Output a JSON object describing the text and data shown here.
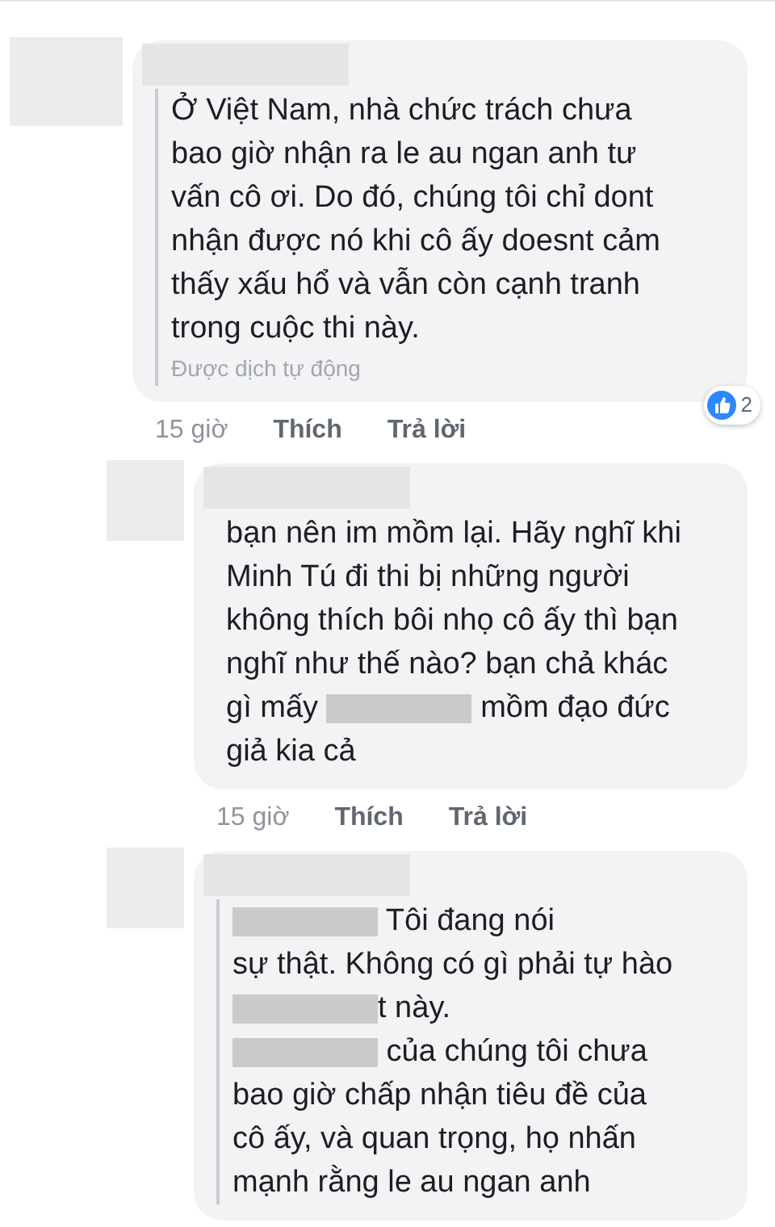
{
  "comments": [
    {
      "translated": true,
      "lines": [
        [
          {
            "kind": "text",
            "text": "Ở Việt Nam, nhà chức trách chưa"
          }
        ],
        [
          {
            "kind": "text",
            "text": "bao giờ nhận ra le au ngan anh tư"
          }
        ],
        [
          {
            "kind": "text",
            "text": "vấn cô ơi. Do đó, chúng tôi chỉ dont"
          }
        ],
        [
          {
            "kind": "text",
            "text": "nhận được nó khi cô ấy doesnt cảm"
          }
        ],
        [
          {
            "kind": "text",
            "text": "thấy xấu hổ và vẫn còn cạnh tranh"
          }
        ],
        [
          {
            "kind": "text",
            "text": "trong cuộc thi này."
          }
        ]
      ],
      "translation_note": "Được dịch tự động",
      "time": "15 giờ",
      "like": "Thích",
      "reply": "Trả lời",
      "reaction_count": "2"
    },
    {
      "translated": false,
      "lines": [
        [
          {
            "kind": "text",
            "text": "bạn nên im mồm lại. Hãy nghĩ khi"
          }
        ],
        [
          {
            "kind": "text",
            "text": "Minh Tú đi thi bị những người"
          }
        ],
        [
          {
            "kind": "text",
            "text": "không thích bôi nhọ cô ấy thì bạn"
          }
        ],
        [
          {
            "kind": "text",
            "text": "nghĩ như thế nào? bạn chả khác"
          }
        ],
        [
          {
            "kind": "text",
            "text": "gì mấy "
          },
          {
            "kind": "redacted"
          },
          {
            "kind": "text",
            "text": " mồm đạo đức"
          }
        ],
        [
          {
            "kind": "text",
            "text": "giả kia cả"
          }
        ]
      ],
      "time": "15 giờ",
      "like": "Thích",
      "reply": "Trả lời"
    },
    {
      "translated": true,
      "lines": [
        [
          {
            "kind": "redacted"
          },
          {
            "kind": "text",
            "text": " Tôi đang nói"
          }
        ],
        [
          {
            "kind": "text",
            "text": "sự thật. Không có gì phải tự hào"
          }
        ],
        [
          {
            "kind": "redacted"
          },
          {
            "kind": "text",
            "text": "t này."
          }
        ],
        [
          {
            "kind": "redacted"
          },
          {
            "kind": "text",
            "text": " của chúng tôi chưa"
          }
        ],
        [
          {
            "kind": "text",
            "text": "bao giờ chấp nhận tiêu đề của"
          }
        ],
        [
          {
            "kind": "text",
            "text": "cô ấy, và quan trọng, họ nhấn"
          }
        ],
        [
          {
            "kind": "text",
            "text": "mạnh rằng le au ngan anh"
          }
        ]
      ]
    }
  ]
}
